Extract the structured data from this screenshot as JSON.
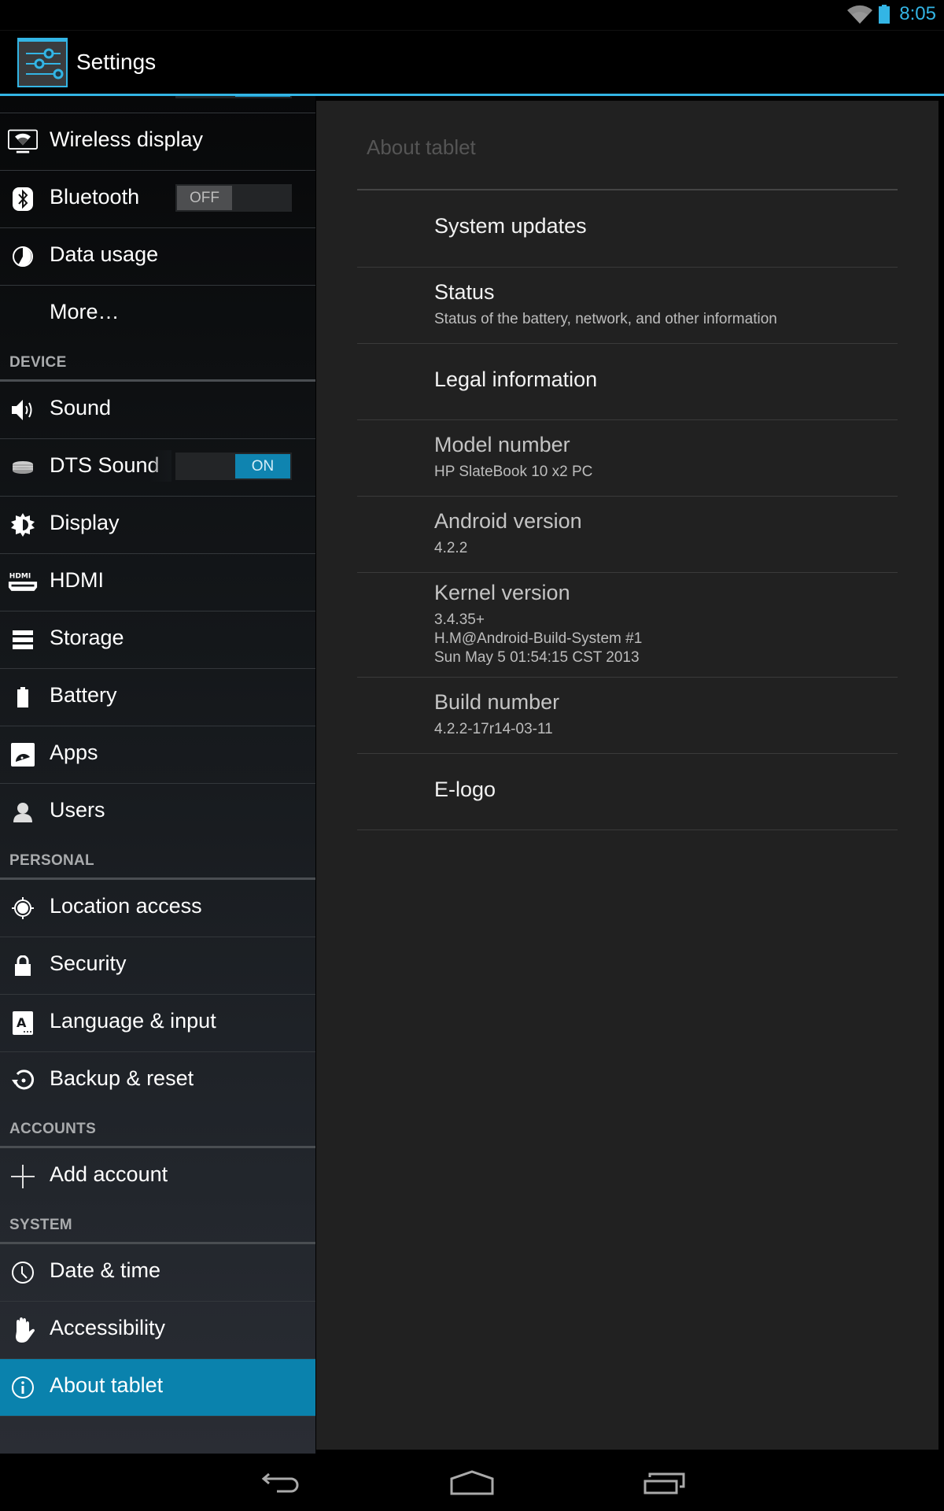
{
  "status_bar": {
    "time": "8:05",
    "icons": [
      "wifi-icon",
      "battery-icon"
    ],
    "accent_color": "#33b5e5"
  },
  "action_bar": {
    "title": "Settings",
    "icon": "settings-sliders-icon"
  },
  "sidebar": {
    "items": [
      {
        "type": "item",
        "label": "Wireless display",
        "icon": "wireless-display-icon"
      },
      {
        "type": "item",
        "label": "Bluetooth",
        "icon": "bluetooth-icon",
        "toggle": "OFF"
      },
      {
        "type": "item",
        "label": "Data usage",
        "icon": "data-usage-icon"
      },
      {
        "type": "item",
        "label": "More…",
        "icon": ""
      },
      {
        "type": "header",
        "label": "DEVICE"
      },
      {
        "type": "item",
        "label": "Sound",
        "icon": "speaker-icon"
      },
      {
        "type": "item",
        "label": "DTS Sound",
        "icon": "dts-icon",
        "toggle": "ON"
      },
      {
        "type": "item",
        "label": "Display",
        "icon": "brightness-icon"
      },
      {
        "type": "item",
        "label": "HDMI",
        "icon": "hdmi-icon"
      },
      {
        "type": "item",
        "label": "Storage",
        "icon": "storage-icon"
      },
      {
        "type": "item",
        "label": "Battery",
        "icon": "battery-icon"
      },
      {
        "type": "item",
        "label": "Apps",
        "icon": "apps-android-icon"
      },
      {
        "type": "item",
        "label": "Users",
        "icon": "user-icon"
      },
      {
        "type": "header",
        "label": "PERSONAL"
      },
      {
        "type": "item",
        "label": "Location access",
        "icon": "location-icon"
      },
      {
        "type": "item",
        "label": "Security",
        "icon": "lock-icon"
      },
      {
        "type": "item",
        "label": "Language & input",
        "icon": "language-icon"
      },
      {
        "type": "item",
        "label": "Backup & reset",
        "icon": "backup-reset-icon"
      },
      {
        "type": "header",
        "label": "ACCOUNTS"
      },
      {
        "type": "item",
        "label": "Add account",
        "icon": "plus-icon"
      },
      {
        "type": "header",
        "label": "SYSTEM"
      },
      {
        "type": "item",
        "label": "Date & time",
        "icon": "clock-icon"
      },
      {
        "type": "item",
        "label": "Accessibility",
        "icon": "hand-icon"
      },
      {
        "type": "item",
        "label": "About tablet",
        "icon": "info-icon",
        "selected": true
      }
    ],
    "selected_color": "#0a82ad"
  },
  "detail": {
    "title": "About tablet",
    "prefs": [
      {
        "title": "System updates",
        "summary": "",
        "enabled": true
      },
      {
        "title": "Status",
        "summary": "Status of the battery, network, and other information",
        "enabled": true
      },
      {
        "title": "Legal information",
        "summary": "",
        "enabled": true
      },
      {
        "title": "Model number",
        "summary": "HP SlateBook 10 x2 PC",
        "enabled": false
      },
      {
        "title": "Android version",
        "summary": "4.2.2",
        "enabled": false
      },
      {
        "title": "Kernel version",
        "summary": "3.4.35+\nH.M@Android-Build-System #1\nSun May 5 01:54:15 CST 2013",
        "enabled": false
      },
      {
        "title": "Build number",
        "summary": "4.2.2-17r14-03-11",
        "enabled": false
      },
      {
        "title": "E-logo",
        "summary": "",
        "enabled": true
      }
    ]
  },
  "nav_bar": {
    "buttons": [
      "back-icon",
      "home-icon",
      "recents-icon"
    ]
  }
}
